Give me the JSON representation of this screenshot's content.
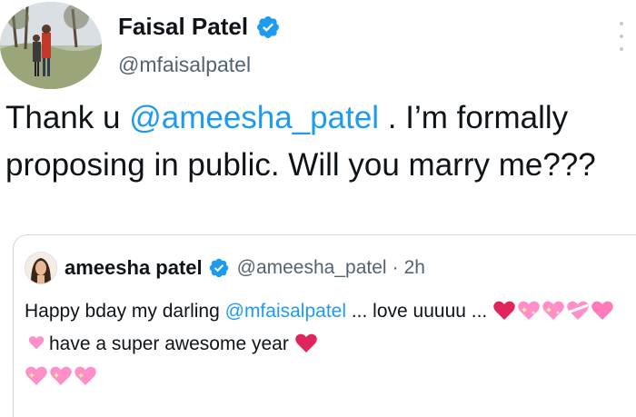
{
  "tweet": {
    "display_name": "Faisal Patel",
    "handle": "@mfaisalpatel",
    "text_pre": "Thank u ",
    "mention": "@ameesha_patel",
    "text_post": " . I’m formally proposing in public. Will you marry me???"
  },
  "quote": {
    "display_name": "ameesha patel",
    "handle": "@ameesha_patel",
    "separator": "·",
    "time": "2h",
    "text_pre": "Happy bday my darling ",
    "mention": "@mfaisalpatel",
    "text_mid": " ... love uuuuu ...",
    "text_post": "have a super awesome year"
  },
  "colors": {
    "verified": "#1d9bf0",
    "mention": "#1d9bf0",
    "red_heart": "#e0245e",
    "sparkle_heart": "#ff8fc8"
  },
  "icons": {
    "verified": "verified-badge-icon",
    "more": "more-options-icon",
    "hearts": [
      "red-heart",
      "sparkling-heart",
      "sparkling-heart",
      "heart-with-ribbon",
      "two-hearts",
      "growing-heart",
      "red-heart",
      "sparkling-heart",
      "sparkling-heart",
      "sparkling-heart"
    ]
  }
}
